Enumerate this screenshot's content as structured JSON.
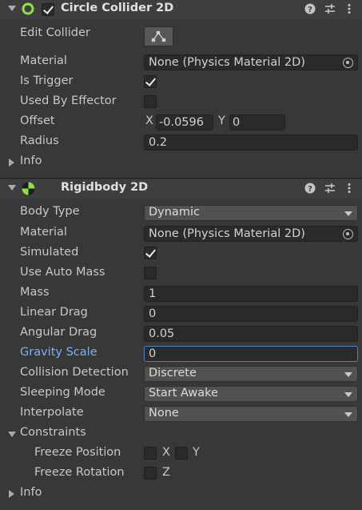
{
  "circle_collider": {
    "title": "Circle Collider 2D",
    "enabled": true,
    "edit_collider_label": "Edit Collider",
    "material_label": "Material",
    "material_value": "None (Physics Material 2D)",
    "is_trigger_label": "Is Trigger",
    "is_trigger": true,
    "used_by_effector_label": "Used By Effector",
    "used_by_effector": false,
    "offset_label": "Offset",
    "offset_x_label": "X",
    "offset_x": "-0.0596",
    "offset_y_label": "Y",
    "offset_y": "0",
    "radius_label": "Radius",
    "radius": "0.2",
    "info_label": "Info"
  },
  "rigidbody": {
    "title": "Rigidbody 2D",
    "body_type_label": "Body Type",
    "body_type": "Dynamic",
    "material_label": "Material",
    "material_value": "None (Physics Material 2D)",
    "simulated_label": "Simulated",
    "simulated": true,
    "use_auto_mass_label": "Use Auto Mass",
    "use_auto_mass": false,
    "mass_label": "Mass",
    "mass": "1",
    "linear_drag_label": "Linear Drag",
    "linear_drag": "0",
    "angular_drag_label": "Angular Drag",
    "angular_drag": "0.05",
    "gravity_scale_label": "Gravity Scale",
    "gravity_scale": "0",
    "collision_detection_label": "Collision Detection",
    "collision_detection": "Discrete",
    "sleeping_mode_label": "Sleeping Mode",
    "sleeping_mode": "Start Awake",
    "interpolate_label": "Interpolate",
    "interpolate": "None",
    "constraints_label": "Constraints",
    "freeze_position_label": "Freeze Position",
    "freeze_position_x_label": "X",
    "freeze_position_x": false,
    "freeze_position_y_label": "Y",
    "freeze_position_y": false,
    "freeze_rotation_label": "Freeze Rotation",
    "freeze_rotation_z_label": "Z",
    "freeze_rotation_z": false,
    "info_label": "Info"
  },
  "header_icons": [
    "help-icon",
    "presets-icon",
    "more-options-icon"
  ],
  "colors": {
    "background": "#383838",
    "header": "#3e3e3e",
    "field": "#2a2a2a",
    "focus_accent": "#4d7fc4",
    "active_label": "#7fb1f0"
  }
}
